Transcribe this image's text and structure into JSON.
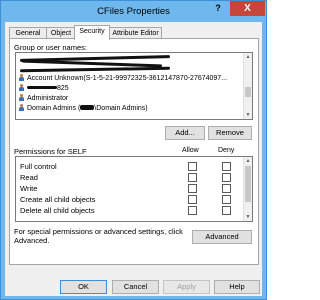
{
  "window": {
    "title": "CFiles Properties",
    "help": "?",
    "close": "X"
  },
  "tabs": [
    "General",
    "Object",
    "Security",
    "Attribute Editor"
  ],
  "groups": {
    "label": "Group or user names:",
    "visible_items": [
      "Account Unknown(S-1-5-21-99972325-3612147870-27674097...",
      "825",
      "Administrator",
      "Domain Admins (",
      "\\Domain Admins)"
    ],
    "add": "Add...",
    "remove": "Remove"
  },
  "permissions": {
    "title": "Permissions for SELF",
    "allow": "Allow",
    "deny": "Deny",
    "items": [
      "Full control",
      "Read",
      "Write",
      "Create all child objects",
      "Delete all child objects"
    ]
  },
  "special": {
    "text": "For special permissions or advanced settings, click Advanced.",
    "button": "Advanced"
  },
  "buttons": {
    "ok": "OK",
    "cancel": "Cancel",
    "apply": "Apply",
    "help": "Help"
  },
  "colors": {
    "titlebar": "#6fb8ee",
    "close": "#c7463c",
    "dialog_bg": "#f0f0f0"
  }
}
